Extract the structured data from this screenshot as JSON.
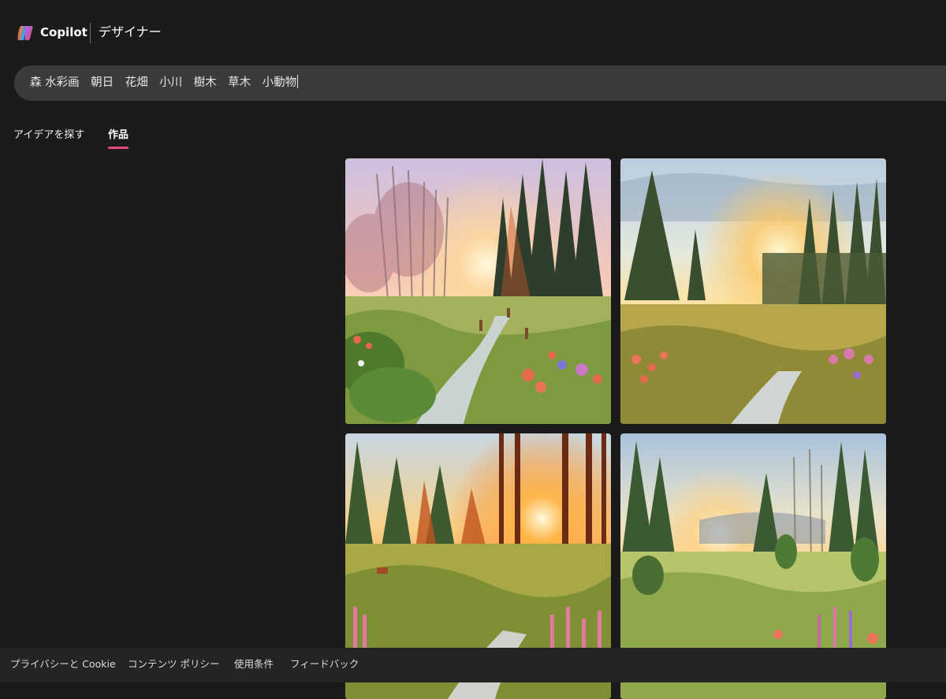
{
  "header": {
    "brand": "Copilot",
    "product": "デザイナー",
    "logo_icon": "copilot-logo-icon"
  },
  "search": {
    "value": "森 水彩画　朝日　花畑　小川　樹木　草木　小動物"
  },
  "tabs": [
    {
      "label": "アイデアを探す",
      "active": false
    },
    {
      "label": "作品",
      "active": true
    }
  ],
  "colors": {
    "background": "#1b1b1b",
    "search_bg": "#3b3b3b",
    "accent_underline": "#e8487d",
    "footer_bg": "#242424"
  },
  "gallery": {
    "images": [
      {
        "name": "generated-image-1"
      },
      {
        "name": "generated-image-2"
      },
      {
        "name": "generated-image-3"
      },
      {
        "name": "generated-image-4"
      }
    ]
  },
  "footer": {
    "links": [
      "プライバシーと Cookie",
      "コンテンツ ポリシー",
      "使用条件",
      "フィードバック"
    ]
  }
}
